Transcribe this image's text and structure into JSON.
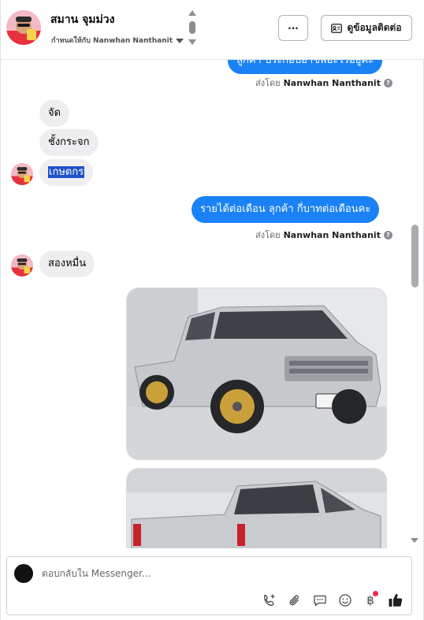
{
  "header": {
    "name": "สมาน จุมม่วง",
    "assigned_to": "กำหนดให้กับ Nanwhan Nanthanit",
    "more_label": "···",
    "contact_button": "ดูข้อมูลติดต่อ"
  },
  "thread": {
    "top_partial_message": "ลูกค้า ประกอบอาชีพอะไรอยู่คะ",
    "sent_by_prefix": "ส่งโดย",
    "sent_by_name": "Nanwhan Nanthanit",
    "incoming_1": "จัด",
    "incoming_2": "ชั้งกระจก",
    "incoming_3": "เกษตกร",
    "outgoing_2": "รายได้ต่อเดือน ลุกค้า กี่บาทต่อเดือนคะ",
    "incoming_4": "สองหมื่น"
  },
  "composer": {
    "placeholder": "ตอบกลับใน Messenger..."
  },
  "colors": {
    "outgoing_bubble": "#1a82f4",
    "incoming_bubble": "#eeeef0",
    "selection": "#1f51c8"
  }
}
